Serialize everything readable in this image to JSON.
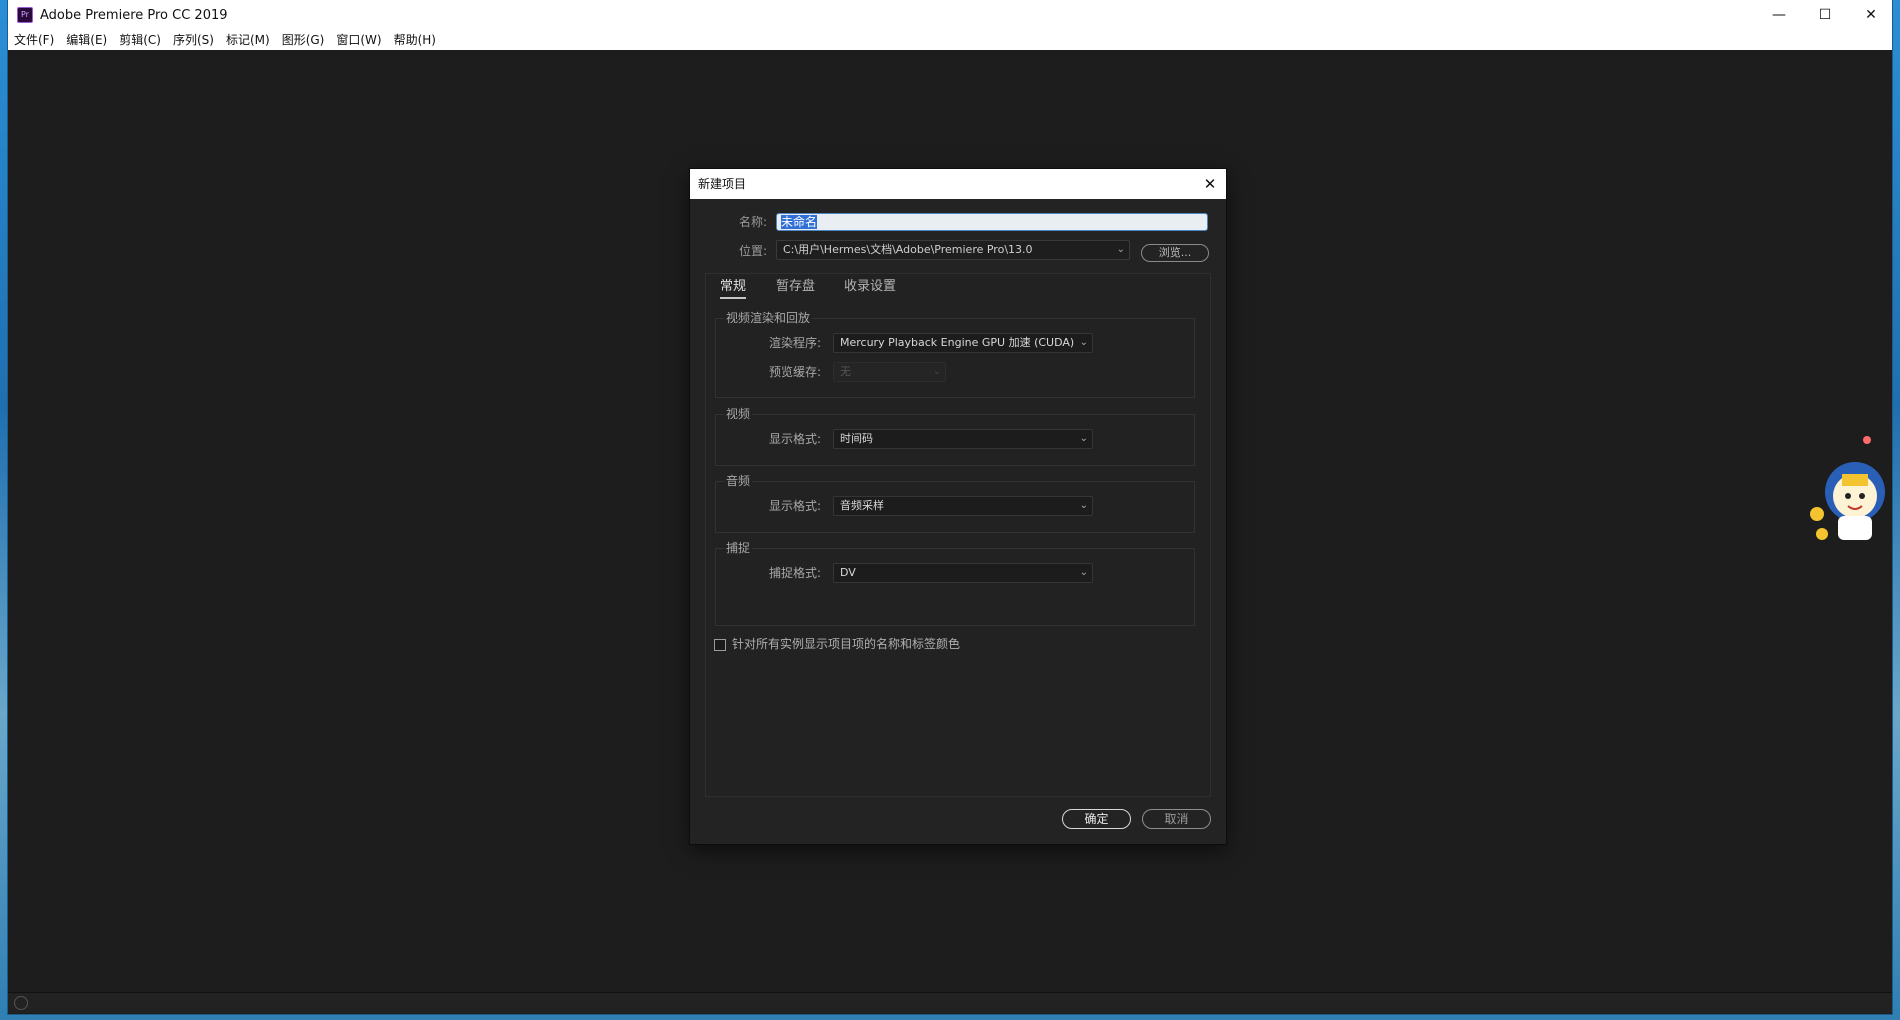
{
  "window": {
    "title": "Adobe Premiere Pro CC 2019",
    "app_icon_text": "Pr",
    "minimize": "—",
    "maximize": "☐",
    "close": "✕"
  },
  "menu": {
    "items": [
      "文件(F)",
      "编辑(E)",
      "剪辑(C)",
      "序列(S)",
      "标记(M)",
      "图形(G)",
      "窗口(W)",
      "帮助(H)"
    ]
  },
  "dialog": {
    "title": "新建项目",
    "close": "✕",
    "name_label": "名称:",
    "name_value": "未命名",
    "location_label": "位置:",
    "location_value": "C:\\用户\\Hermes\\文档\\Adobe\\Premiere Pro\\13.0",
    "browse_label": "浏览...",
    "tabs": [
      "常规",
      "暂存盘",
      "收录设置"
    ],
    "groups": {
      "render": {
        "title": "视频渲染和回放",
        "renderer_label": "渲染程序:",
        "renderer_value": "Mercury Playback Engine GPU 加速 (CUDA)",
        "preview_cache_label": "预览缓存:",
        "preview_cache_value": "无"
      },
      "video": {
        "title": "视频",
        "display_format_label": "显示格式:",
        "display_format_value": "时间码"
      },
      "audio": {
        "title": "音频",
        "display_format_label": "显示格式:",
        "display_format_value": "音频采样"
      },
      "capture": {
        "title": "捕捉",
        "capture_format_label": "捕捉格式:",
        "capture_format_value": "DV"
      }
    },
    "instance_checkbox_label": "针对所有实例显示项目项的名称和标签颜色",
    "instance_checkbox_checked": false,
    "ok_label": "确定",
    "cancel_label": "取消"
  },
  "colors": {
    "workspace_bg": "#1d1d1d",
    "dialog_bg": "#232323",
    "selection": "#2f6fd6"
  }
}
